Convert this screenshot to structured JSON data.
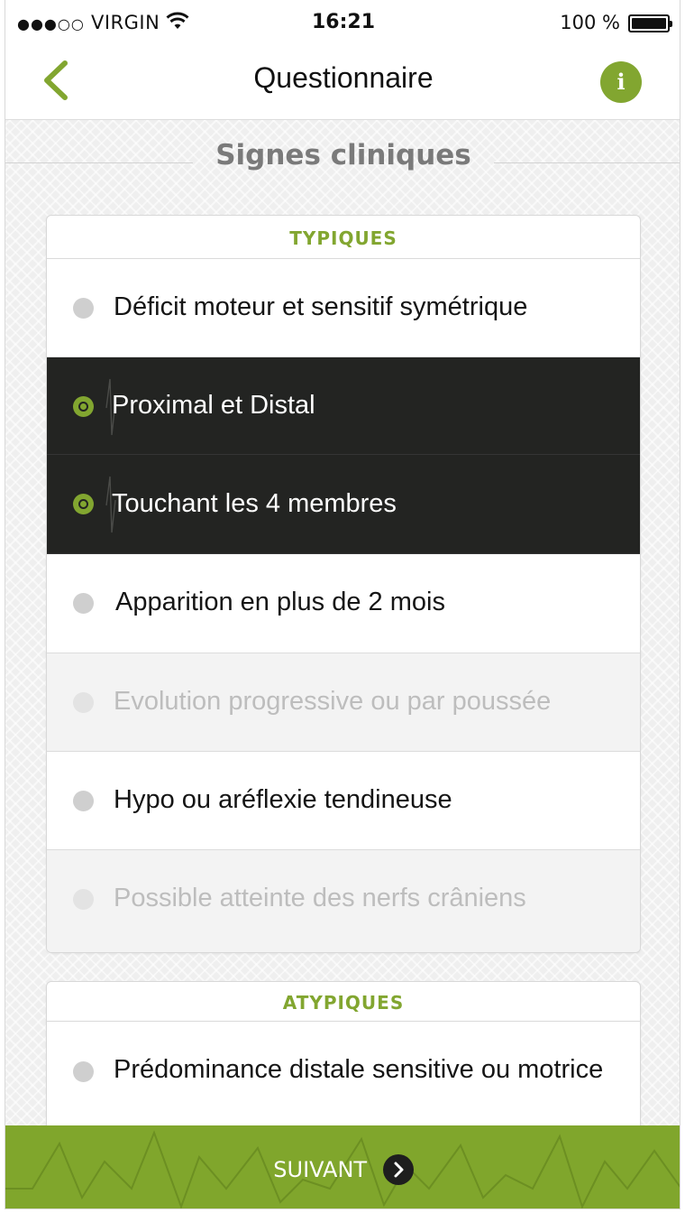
{
  "status_bar": {
    "signal": "●●●○○",
    "carrier": "VIRGIN",
    "time": "16:21",
    "battery": "100 %"
  },
  "nav": {
    "title": "Questionnaire",
    "info_label": "i"
  },
  "section": {
    "title": "Signes cliniques"
  },
  "typiques": {
    "header": "TYPIQUES",
    "items": [
      {
        "label": "Déficit moteur et sensitif symétrique",
        "state": "normal"
      },
      {
        "label": "Proximal et Distal",
        "state": "selected"
      },
      {
        "label": "Touchant les 4 membres",
        "state": "selected"
      },
      {
        "label": "Apparition en plus de 2 mois",
        "state": "normal"
      },
      {
        "label": "Evolution progressive ou par poussée",
        "state": "disabled"
      },
      {
        "label": "Hypo ou aréflexie tendineuse",
        "state": "normal"
      },
      {
        "label": "Possible atteinte des nerfs crâniens",
        "state": "disabled"
      }
    ]
  },
  "atypiques": {
    "header": "ATYPIQUES",
    "items": [
      {
        "label": "Prédominance distale sensitive ou motrice",
        "state": "normal"
      }
    ]
  },
  "footer": {
    "button_label": "SUIVANT"
  },
  "colors": {
    "accent": "#82a630",
    "selected_bg": "#232422",
    "disabled_text": "#bdbdbd"
  },
  "icons": {
    "back": "chevron-left-icon",
    "info": "info-icon",
    "next": "chevron-right-icon"
  }
}
